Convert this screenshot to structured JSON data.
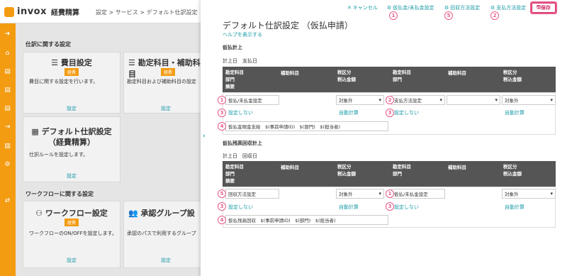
{
  "app": {
    "logo": "invox",
    "product": "経費精算"
  },
  "breadcrumb": "設定 > サービス > デフォルト仕訳設定（仮",
  "bg": {
    "section1": "仕訳に関する設定",
    "section2": "ワークフローに関する設定",
    "cards": [
      {
        "title": "費目設定",
        "badge": "経費",
        "desc": "費目に関する設定を行います。",
        "link": "設定"
      },
      {
        "title": "勘定科目・補助科目",
        "badge": "経費",
        "desc": "勘定科目および補助科目の設定",
        "link": "設定"
      },
      {
        "title": "デフォルト仕訳設定\n（経費精算）",
        "title1": "デフォルト仕訳設定",
        "title2": "（経費精算）",
        "desc": "仕訳ルールを設定します。",
        "link": "設定"
      },
      {
        "title": "ワークフロー設定",
        "badge": "経費",
        "desc": "ワークフローのON/OFFを設定します。",
        "link": "設定"
      },
      {
        "title": "承認グループ設",
        "desc": "承認のパスで利用するグループ",
        "link": "設定"
      }
    ]
  },
  "toolbar": {
    "cancel": "キャンセル",
    "suspense_setting": "仮払金/未払金設定",
    "collection_setting": "回収方法設定",
    "payment_setting": "支払方法設定",
    "save": "保存"
  },
  "panel": {
    "title": "デフォルト仕訳設定 （仮払申請）",
    "help": "ヘルプを表示する",
    "group1": {
      "title": "仮払計上",
      "sub": "計上日　支払日",
      "headers": {
        "c1": [
          "勘定科目",
          "部門",
          "摘要"
        ],
        "c2": "補助科目",
        "c3": [
          "税区分",
          "税込金額"
        ],
        "c4": [
          "勘定科目",
          "部門"
        ],
        "c5": "補助科目",
        "c6": [
          "税区分",
          "税込金額"
        ]
      },
      "debit_account": "仮払/未払金設定",
      "debit_tax": "対象外",
      "debit_dept": "設定しない",
      "debit_amount": "自動計算",
      "credit_account": "支払方法設定",
      "credit_tax": "対象外",
      "credit_dept": "設定しない",
      "credit_amount": "自動計算",
      "memo": "仮払金現金支給　$(事前申請ID)　$(部門)　$(担当者)"
    },
    "group2": {
      "title": "仮払残高回収計上",
      "sub": "計上日　回収日",
      "headers": {
        "c1": [
          "勘定科目",
          "部門",
          "摘要"
        ],
        "c2": "補助科目",
        "c3": [
          "税区分",
          "税込金額"
        ],
        "c4": [
          "勘定科目",
          "部門"
        ],
        "c5": "補助科目",
        "c6": [
          "税区分",
          "税込金額"
        ]
      },
      "debit_account": "回収方法設定",
      "debit_tax": "対象外",
      "debit_dept": "設定しない",
      "debit_amount": "自動計算",
      "credit_account": "仮払/未払金設定",
      "credit_tax": "対象外",
      "credit_dept": "設定しない",
      "credit_amount": "自動計算",
      "memo": "仮払残高回収　$(事前申請ID)　$(部門)　$(担当者)"
    }
  },
  "markers": {
    "m1": "1",
    "m2": "2",
    "m3": "3",
    "m4": "4",
    "m5": "5"
  },
  "colors": {
    "accent": "#1a9aa8",
    "brand": "#f39c12",
    "highlight": "#e85a8a"
  }
}
